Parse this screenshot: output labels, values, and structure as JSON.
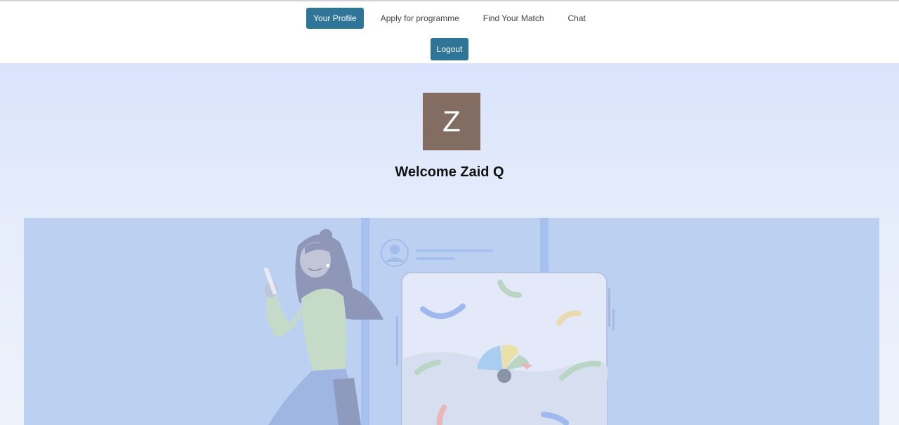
{
  "nav": {
    "items": [
      {
        "label": "Your Profile",
        "active": true
      },
      {
        "label": "Apply for programme",
        "active": false
      },
      {
        "label": "Find Your Match",
        "active": false
      },
      {
        "label": "Chat",
        "active": false
      }
    ],
    "logout_label": "Logout"
  },
  "profile": {
    "avatar_initial": "Z",
    "avatar_color": "#836c61",
    "welcome": "Welcome Zaid Q"
  },
  "colors": {
    "accent": "#2e7598",
    "hero_background": "#d9e3fb",
    "illustration_background": "#bcd0f2"
  }
}
